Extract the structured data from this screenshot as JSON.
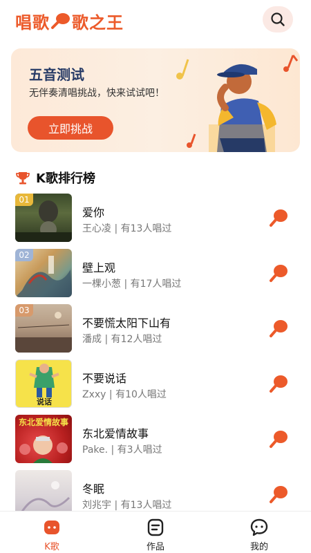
{
  "app": {
    "logo_left": "唱歌",
    "logo_right": "歌之王"
  },
  "banner": {
    "title": "五音测试",
    "subtitle": "无伴奏清唱挑战，快来试试吧！",
    "button": "立即挑战"
  },
  "ranking": {
    "title": "K歌排行榜",
    "items": [
      {
        "rank": "01",
        "song": "爱你",
        "meta": "王心凌 | 有13人唱过",
        "rank_color": "#e8b83a"
      },
      {
        "rank": "02",
        "song": "壁上观",
        "meta": "一棵小葱 | 有17人唱过",
        "rank_color": "#9fb4d6"
      },
      {
        "rank": "03",
        "song": "不要慌太阳下山有",
        "meta": "潘成 | 有12人唱过",
        "rank_color": "#d79a6c"
      },
      {
        "rank": "",
        "song": "不要说话",
        "meta": "Zxxy | 有10人唱过",
        "rank_color": ""
      },
      {
        "rank": "",
        "song": "东北爱情故事",
        "meta": "Pake. | 有3人唱过",
        "rank_color": ""
      },
      {
        "rank": "",
        "song": "冬眠",
        "meta": "刘兆宇 | 有13人唱过",
        "rank_color": ""
      }
    ],
    "cover4_text": "说话",
    "cover5_text": "东北爱情故事"
  },
  "tabs": [
    {
      "label": "K歌",
      "active": true
    },
    {
      "label": "作品",
      "active": false
    },
    {
      "label": "我的",
      "active": false
    }
  ],
  "colors": {
    "accent": "#e8542c",
    "navy": "#263a66"
  }
}
